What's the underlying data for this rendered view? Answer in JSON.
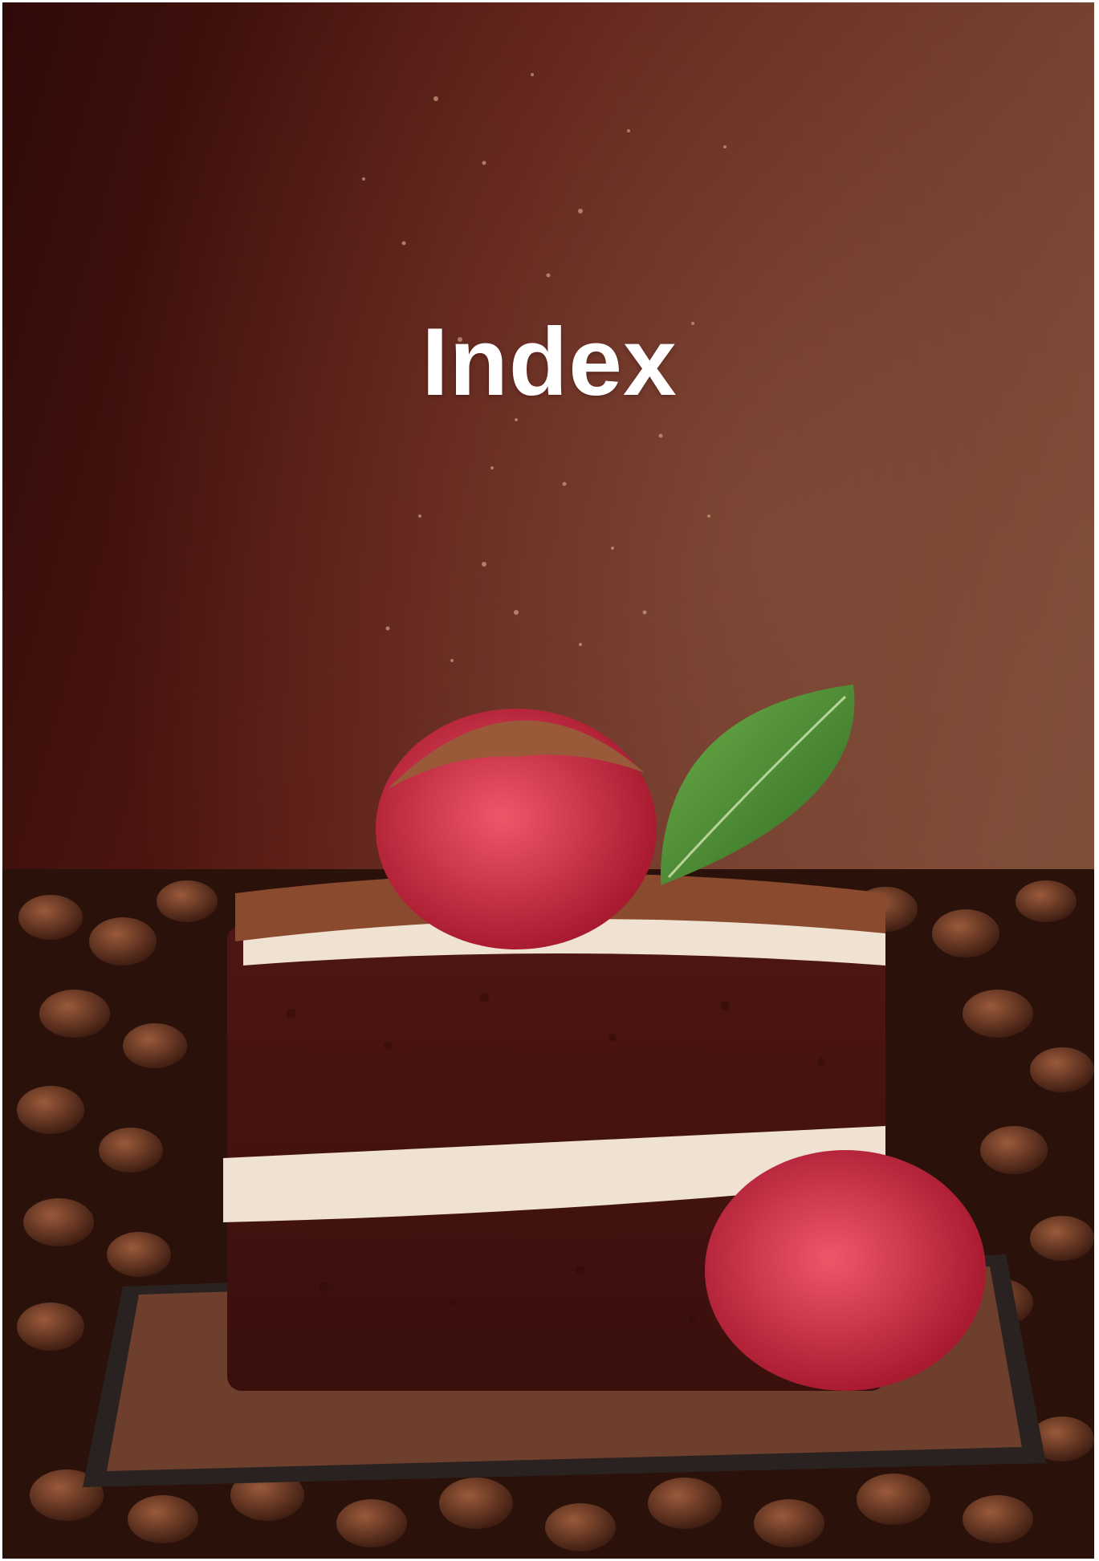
{
  "page": {
    "title": "Index"
  },
  "photo": {
    "subject": "chocolate-layer-cake-with-raspberries",
    "colors": {
      "background_dark": "#3a0e0b",
      "background_warm": "#7a3a2a",
      "cake": "#5a1a16",
      "cream": "#efe2d2",
      "raspberry": "#d8344a",
      "mint": "#3f8a2e",
      "cocoa": "#8a4a2e",
      "beans": "#4a2416"
    }
  }
}
